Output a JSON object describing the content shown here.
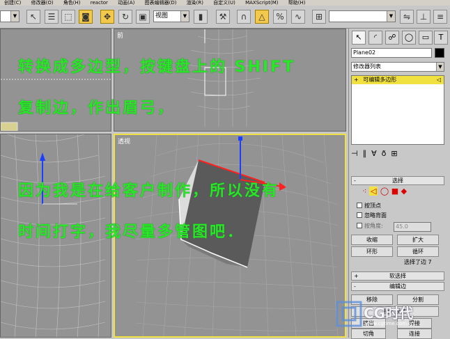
{
  "menubar": {
    "items": [
      "创建(C)",
      "修改器(O)",
      "角色(H)",
      "reactor",
      "动画(A)",
      "图表编辑器(D)",
      "渲染(R)",
      "自定义(U)",
      "MAXScript(M)",
      "帮助(H)"
    ]
  },
  "toolbar": {
    "view_select": "视图",
    "named_selection": ""
  },
  "viewports": {
    "front_label": "前",
    "persp_label": "透视"
  },
  "overlay_text": {
    "line1": "转换成多边型，按键盘上的 SHIFT",
    "line2": "复制边，作出眉弓，",
    "line3": "因为我是在给客户制作，所以没有",
    "line4": "时间打字，我尽量多管图吧．"
  },
  "command_panel": {
    "object_name": "Plane02",
    "modifier_list": "修改器列表",
    "stack_item": "可编辑多边形",
    "selection_rollout": "选择",
    "by_vertex": "按顶点",
    "ignore_backfacing": "忽略背面",
    "by_angle": "按角度:",
    "angle_value": "45.0",
    "shrink": "收缩",
    "grow": "扩大",
    "ring": "环形",
    "loop": "循环",
    "selected_status": "选择了边 7",
    "soft_selection": "软选择",
    "edit_edges": "编辑边",
    "remove": "移除",
    "split": "分割",
    "insert_vertex": "插入顶点",
    "extrude": "挤出",
    "weld": "焊接",
    "chamfer": "切角",
    "connect": "连接",
    "plus": "+",
    "minus": "-"
  },
  "watermark": {
    "brand": "CG时代",
    "url": "www.cgtime.com.cn"
  },
  "colors": {
    "overlay_green": "#29e629",
    "active_border": "#f0e040",
    "viewport_bg": "#939393"
  }
}
